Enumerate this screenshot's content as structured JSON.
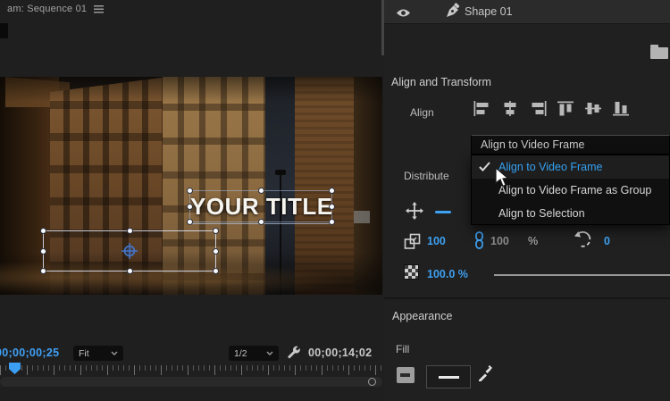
{
  "colors": {
    "accent_blue": "#3da1f2",
    "menu_selected_text": "#35a0f0",
    "panel_bg": "#202020"
  },
  "program_monitor": {
    "tab": {
      "title": "am: Sequence 01"
    },
    "overlay": {
      "title_text": "YOUR TITLE"
    },
    "transport": {
      "current_timecode": "00;00;00;25",
      "zoom_level": "Fit",
      "playback_resolution": "1/2",
      "duration_timecode": "00;00;14;02"
    }
  },
  "essential_graphics": {
    "layer_row": {
      "name": "Shape 01",
      "icons": [
        "eye-icon",
        "pen-icon"
      ]
    },
    "browse_icon": "folder-icon",
    "align_transform": {
      "section_title": "Align and Transform",
      "align_label": "Align",
      "align_icons": [
        "align-left-icon",
        "align-center-horizontal-icon",
        "align-right-icon",
        "align-top-icon",
        "align-center-vertical-icon",
        "align-bottom-icon"
      ],
      "distribute_label": "Distribute",
      "position_icon": "move-icon",
      "scale": {
        "value": "100",
        "linked_value": "100",
        "unit": "%"
      },
      "rotation": {
        "value": "0"
      },
      "opacity": {
        "value": "100.0 %"
      }
    },
    "appearance": {
      "section_title": "Appearance",
      "fill_label": "Fill"
    }
  },
  "align_dropdown": {
    "trigger_label": "Align to Video Frame",
    "items": [
      {
        "label": "Align to Video Frame",
        "checked": true
      },
      {
        "label": "Align to Video Frame as Group",
        "checked": false
      },
      {
        "label": "Align to Selection",
        "checked": false
      }
    ]
  }
}
